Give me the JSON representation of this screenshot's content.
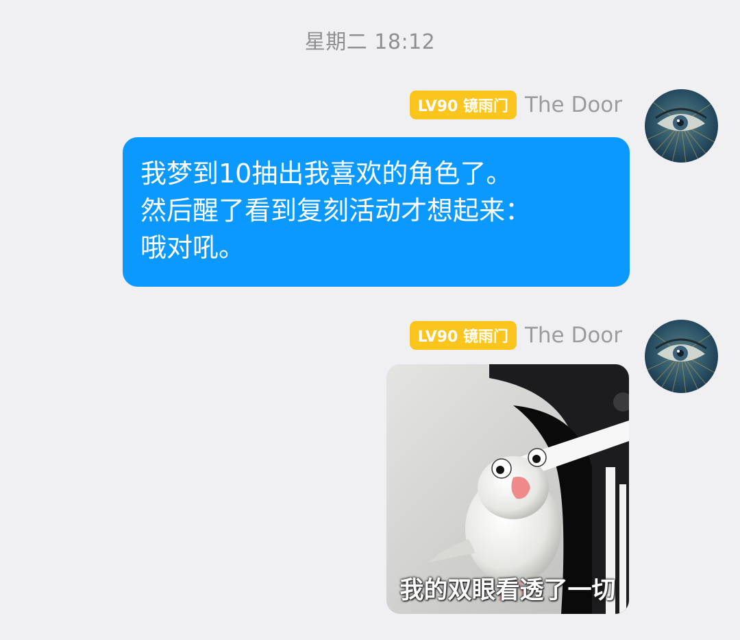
{
  "timestamp": "星期二 18:12",
  "messages": [
    {
      "badge": "LV90 镜雨门",
      "sender": "The Door",
      "avatar_icon": "eye-avatar",
      "type": "text",
      "lines": [
        "我梦到10抽出我喜欢的角色了。",
        "然后醒了看到复刻活动才想起来：",
        "哦对吼。"
      ]
    },
    {
      "badge": "LV90 镜雨门",
      "sender": "The Door",
      "avatar_icon": "eye-avatar",
      "type": "sticker",
      "sticker_icon": "white-bird-sticker",
      "caption": "我的双眼看透了一切"
    }
  ],
  "colors": {
    "background": "#f0f0f3",
    "bubble": "#0b99ff",
    "badge": "#fcc51d",
    "timestamp": "#8e8e93",
    "sender": "#9a9aa0"
  }
}
